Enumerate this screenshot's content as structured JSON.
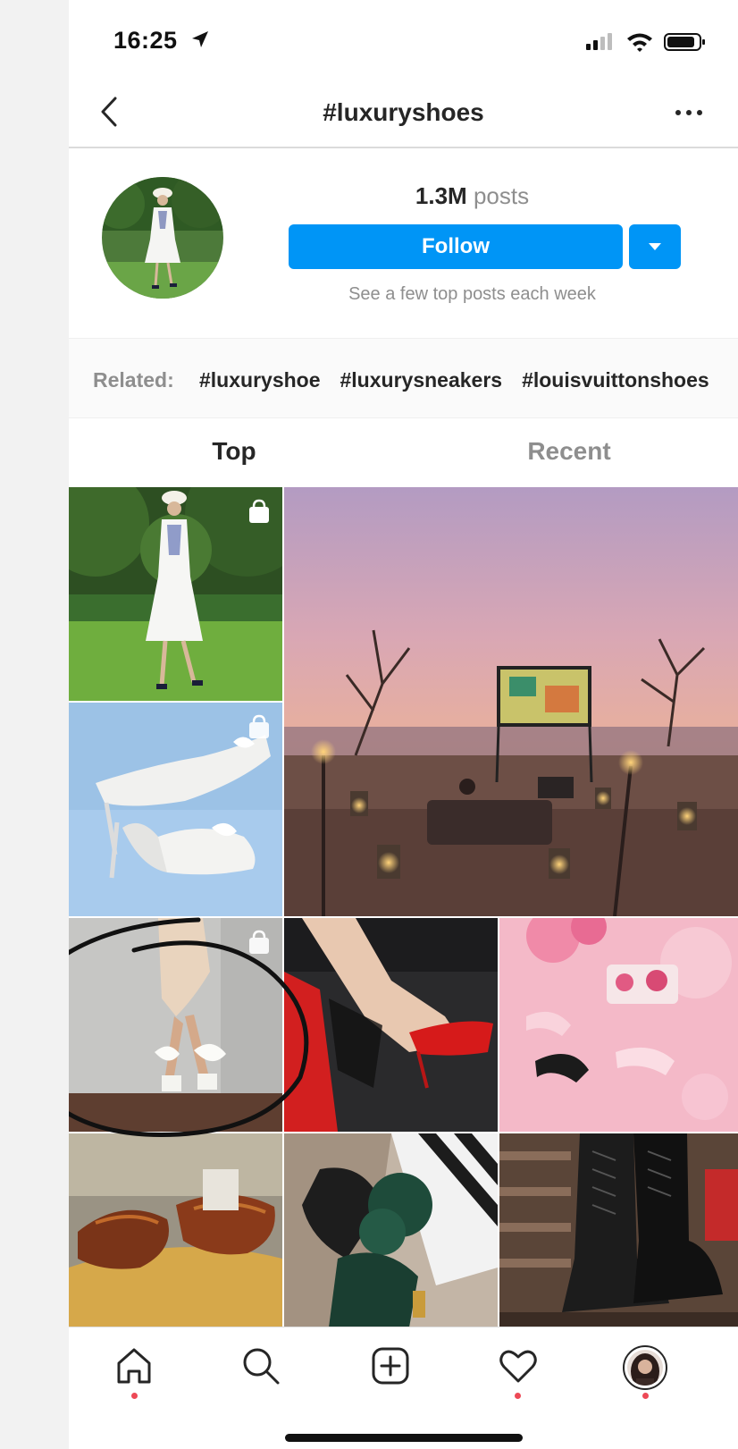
{
  "status_bar": {
    "time": "16:25",
    "icons": [
      "location-arrow-icon",
      "signal-icon",
      "wifi-icon",
      "battery-icon"
    ]
  },
  "header": {
    "title": "#luxuryshoes",
    "back_icon": "chevron-left-icon",
    "more_icon": "ellipsis-icon"
  },
  "profile": {
    "post_count": "1.3M",
    "post_label": "posts",
    "follow_label": "Follow",
    "hint": "See a few top posts each week"
  },
  "related": {
    "label": "Related:",
    "tags": [
      "#luxuryshoe",
      "#luxurysneakers",
      "#louisvuittonshoes"
    ]
  },
  "tabs": [
    {
      "label": "Top",
      "active": true
    },
    {
      "label": "Recent",
      "active": false
    }
  ],
  "grid": {
    "tiles": [
      {
        "name": "post-white-dress",
        "has_shop_icon": true
      },
      {
        "name": "post-beach-cinema",
        "has_shop_icon": false
      },
      {
        "name": "post-white-bow-pumps",
        "has_shop_icon": true
      },
      {
        "name": "post-white-sandals",
        "has_shop_icon": true
      },
      {
        "name": "post-red-pumps",
        "has_shop_icon": false
      },
      {
        "name": "post-pink-heels",
        "has_shop_icon": false
      },
      {
        "name": "post-brown-oxfords",
        "has_shop_icon": false
      },
      {
        "name": "post-fur-mules",
        "has_shop_icon": false
      },
      {
        "name": "post-black-boots",
        "has_shop_icon": false
      }
    ]
  },
  "bottom_nav": [
    "home-icon",
    "search-icon",
    "add-post-icon",
    "heart-icon",
    "profile-avatar"
  ],
  "colors": {
    "accent": "#0095f6",
    "notification_dot": "#ed4956",
    "text_primary": "#262626",
    "text_secondary": "#8e8e8e"
  }
}
